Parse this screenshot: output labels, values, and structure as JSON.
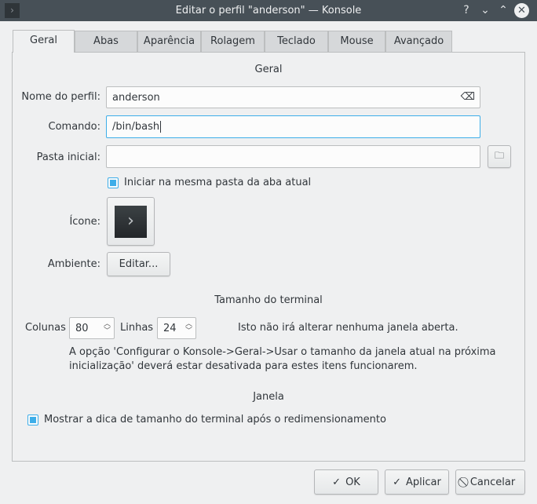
{
  "window": {
    "title": "Editar o perfil \"anderson\" — Konsole",
    "help": "?",
    "minimize": "⌄",
    "maximize": "⌃",
    "close": "✕"
  },
  "tabs": [
    "Geral",
    "Abas",
    "Aparência",
    "Rolagem",
    "Teclado",
    "Mouse",
    "Avançado"
  ],
  "general": {
    "section_title": "Geral",
    "profile_name_label": "Nome do perfil:",
    "profile_name_value": "anderson",
    "command_label": "Comando:",
    "command_value": "/bin/bash",
    "initial_dir_label": "Pasta inicial:",
    "initial_dir_value": "",
    "same_dir_checkbox": "Iniciar na mesma pasta da aba atual",
    "same_dir_checked": true,
    "icon_label": "Ícone:",
    "environment_label": "Ambiente:",
    "environment_button": "Editar..."
  },
  "terminal_size": {
    "section_title": "Tamanho do terminal",
    "columns_label": "Colunas",
    "columns_value": "80",
    "rows_label": "Linhas",
    "rows_value": "24",
    "info": "Isto não irá alterar nenhuma janela aberta.",
    "note_line1": "A opção 'Configurar o Konsole->Geral->Usar o tamanho da janela atual na próxima",
    "note_line2": "inicialização' deverá estar desativada para estes itens funcionarem."
  },
  "window_section": {
    "section_title": "Janela",
    "show_size_hint": "Mostrar a dica de tamanho do terminal após o redimensionamento",
    "show_size_hint_checked": true
  },
  "buttons": {
    "ok": "OK",
    "apply": "Aplicar",
    "cancel": "Cancelar"
  }
}
